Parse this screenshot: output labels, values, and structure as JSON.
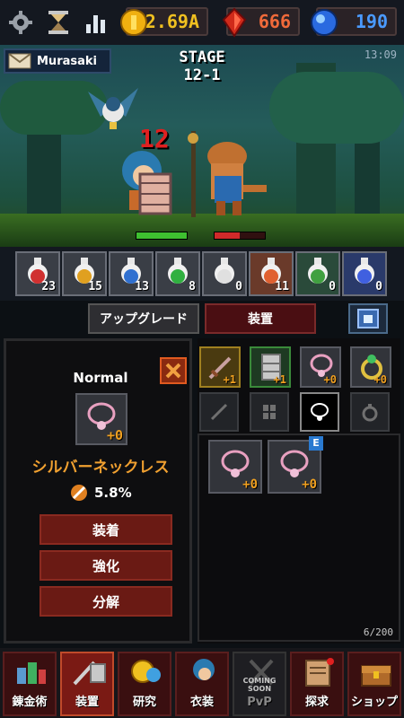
{
  "header": {
    "gold": "2.69A",
    "rubies": "666",
    "gems": "190"
  },
  "battle": {
    "player_name": "Murasaki",
    "stage_label": "STAGE",
    "stage_number": "12-1",
    "clock": "13:09",
    "damage": "12",
    "player_hp": 1.0,
    "enemy_hp": 0.5
  },
  "potions": [
    {
      "count": "23",
      "color": "#d03030"
    },
    {
      "count": "15",
      "color": "#e0a020"
    },
    {
      "count": "13",
      "color": "#3070d0"
    },
    {
      "count": "8",
      "color": "#30b040"
    },
    {
      "count": "0",
      "color": "#e0e0e0"
    },
    {
      "count": "11",
      "color": "#e06030"
    },
    {
      "count": "0",
      "color": "#40a040"
    },
    {
      "count": "0",
      "color": "#4060e0"
    }
  ],
  "tabs": {
    "upgrade": "アップグレード",
    "equipment": "装置"
  },
  "item": {
    "rarity": "Normal",
    "name": "シルバーネックレス",
    "stat": "5.8%",
    "level": "+0",
    "equip_button": "装着",
    "enhance_button": "強化",
    "dismantle_button": "分解"
  },
  "equipped": [
    {
      "name": "sword",
      "level": "+1"
    },
    {
      "name": "armor",
      "level": "+1"
    },
    {
      "name": "necklace",
      "level": "+0"
    },
    {
      "name": "ring",
      "level": "+0"
    }
  ],
  "inventory": {
    "items": [
      {
        "level": "+0",
        "badge": ""
      },
      {
        "level": "+0",
        "badge": "E"
      }
    ],
    "capacity": "6/200"
  },
  "nav": [
    {
      "label": "錬金術",
      "icon": "alchemy-icon"
    },
    {
      "label": "装置",
      "icon": "equipment-icon"
    },
    {
      "label": "研究",
      "icon": "research-icon"
    },
    {
      "label": "衣装",
      "icon": "costume-icon"
    },
    {
      "label": "PvP",
      "icon": "pvp-icon",
      "note": "COMING SOON"
    },
    {
      "label": "探求",
      "icon": "quest-icon"
    },
    {
      "label": "ショップ",
      "icon": "shop-icon"
    }
  ]
}
